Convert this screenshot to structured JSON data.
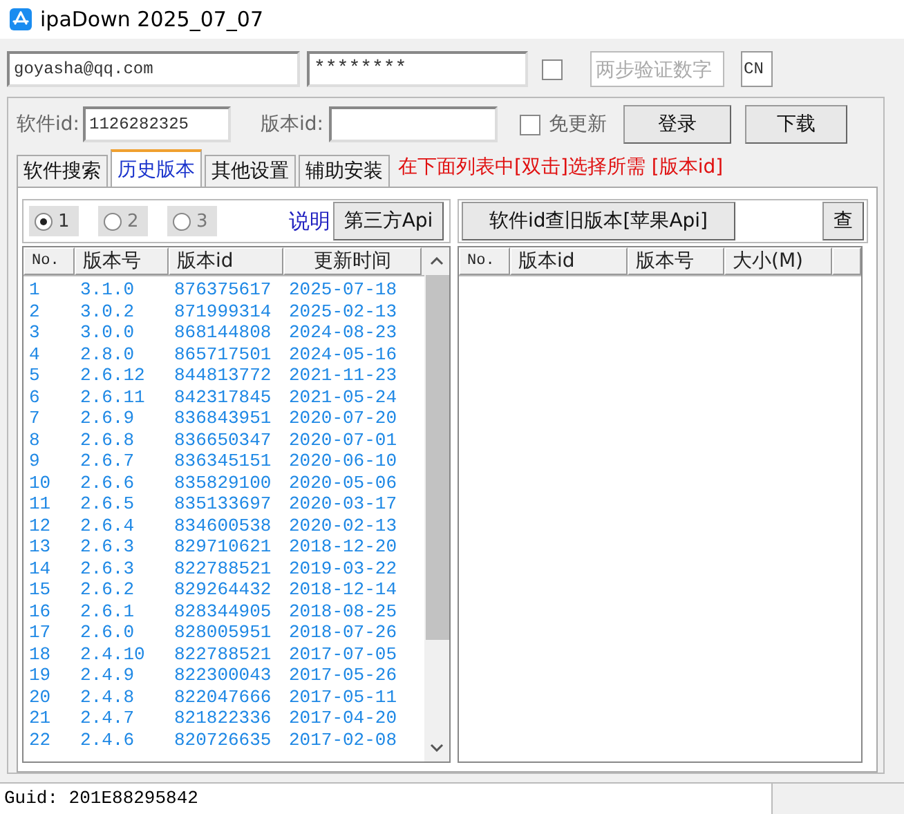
{
  "window": {
    "title": "ipaDown 2025_07_07"
  },
  "login": {
    "email": "goyasha@qq.com",
    "password": "********",
    "twofa_checked": false,
    "twofa_placeholder": "两步验证数字",
    "region": "CN"
  },
  "app_row": {
    "app_id_label": "软件id:",
    "app_id": "1126282325",
    "version_id_label": "版本id:",
    "no_update_label": "免更新",
    "no_update_checked": false,
    "buttons": [
      "登录",
      "下载"
    ]
  },
  "tabs": [
    {
      "label": "软件搜索",
      "selected": false
    },
    {
      "label": "历史版本",
      "selected": true
    },
    {
      "label": "其他设置",
      "selected": false
    },
    {
      "label": "辅助安装",
      "selected": false
    }
  ],
  "hint": "在下面列表中[双击]选择所需 [版本id]",
  "left_panel": {
    "radios": [
      {
        "label": "1",
        "selected": true
      },
      {
        "label": "2",
        "selected": false
      },
      {
        "label": "3",
        "selected": false
      }
    ],
    "help_link": "说明",
    "api_button": "第三方Api",
    "columns": [
      "No.",
      "版本号",
      "版本id",
      "更新时间"
    ],
    "rows": [
      [
        "1",
        "3.1.0",
        "876375617",
        "2025-07-18"
      ],
      [
        "2",
        "3.0.2",
        "871999314",
        "2025-02-13"
      ],
      [
        "3",
        "3.0.0",
        "868144808",
        "2024-08-23"
      ],
      [
        "4",
        "2.8.0",
        "865717501",
        "2024-05-16"
      ],
      [
        "5",
        "2.6.12",
        "844813772",
        "2021-11-23"
      ],
      [
        "6",
        "2.6.11",
        "842317845",
        "2021-05-24"
      ],
      [
        "7",
        "2.6.9",
        "836843951",
        "2020-07-20"
      ],
      [
        "8",
        "2.6.8",
        "836650347",
        "2020-07-01"
      ],
      [
        "9",
        "2.6.7",
        "836345151",
        "2020-06-10"
      ],
      [
        "10",
        "2.6.6",
        "835829100",
        "2020-05-06"
      ],
      [
        "11",
        "2.6.5",
        "835133697",
        "2020-03-17"
      ],
      [
        "12",
        "2.6.4",
        "834600538",
        "2020-02-13"
      ],
      [
        "13",
        "2.6.3",
        "829710621",
        "2018-12-20"
      ],
      [
        "14",
        "2.6.3",
        "822788521",
        "2019-03-22"
      ],
      [
        "15",
        "2.6.2",
        "829264432",
        "2018-12-14"
      ],
      [
        "16",
        "2.6.1",
        "828344905",
        "2018-08-25"
      ],
      [
        "17",
        "2.6.0",
        "828005951",
        "2018-07-26"
      ],
      [
        "18",
        "2.4.10",
        "822788521",
        "2017-07-05"
      ],
      [
        "19",
        "2.4.9",
        "822300043",
        "2017-05-26"
      ],
      [
        "20",
        "2.4.8",
        "822047666",
        "2017-05-11"
      ],
      [
        "21",
        "2.4.7",
        "821822336",
        "2017-04-20"
      ],
      [
        "22",
        "2.4.6",
        "820726635",
        "2017-02-08"
      ]
    ]
  },
  "right_panel": {
    "query_button": "软件id查旧版本[苹果Api]",
    "search_button": "查",
    "columns": [
      "No.",
      "版本id",
      "版本号",
      "大小(M)"
    ]
  },
  "status_bar": {
    "text": "Guid: 201E88295842"
  }
}
